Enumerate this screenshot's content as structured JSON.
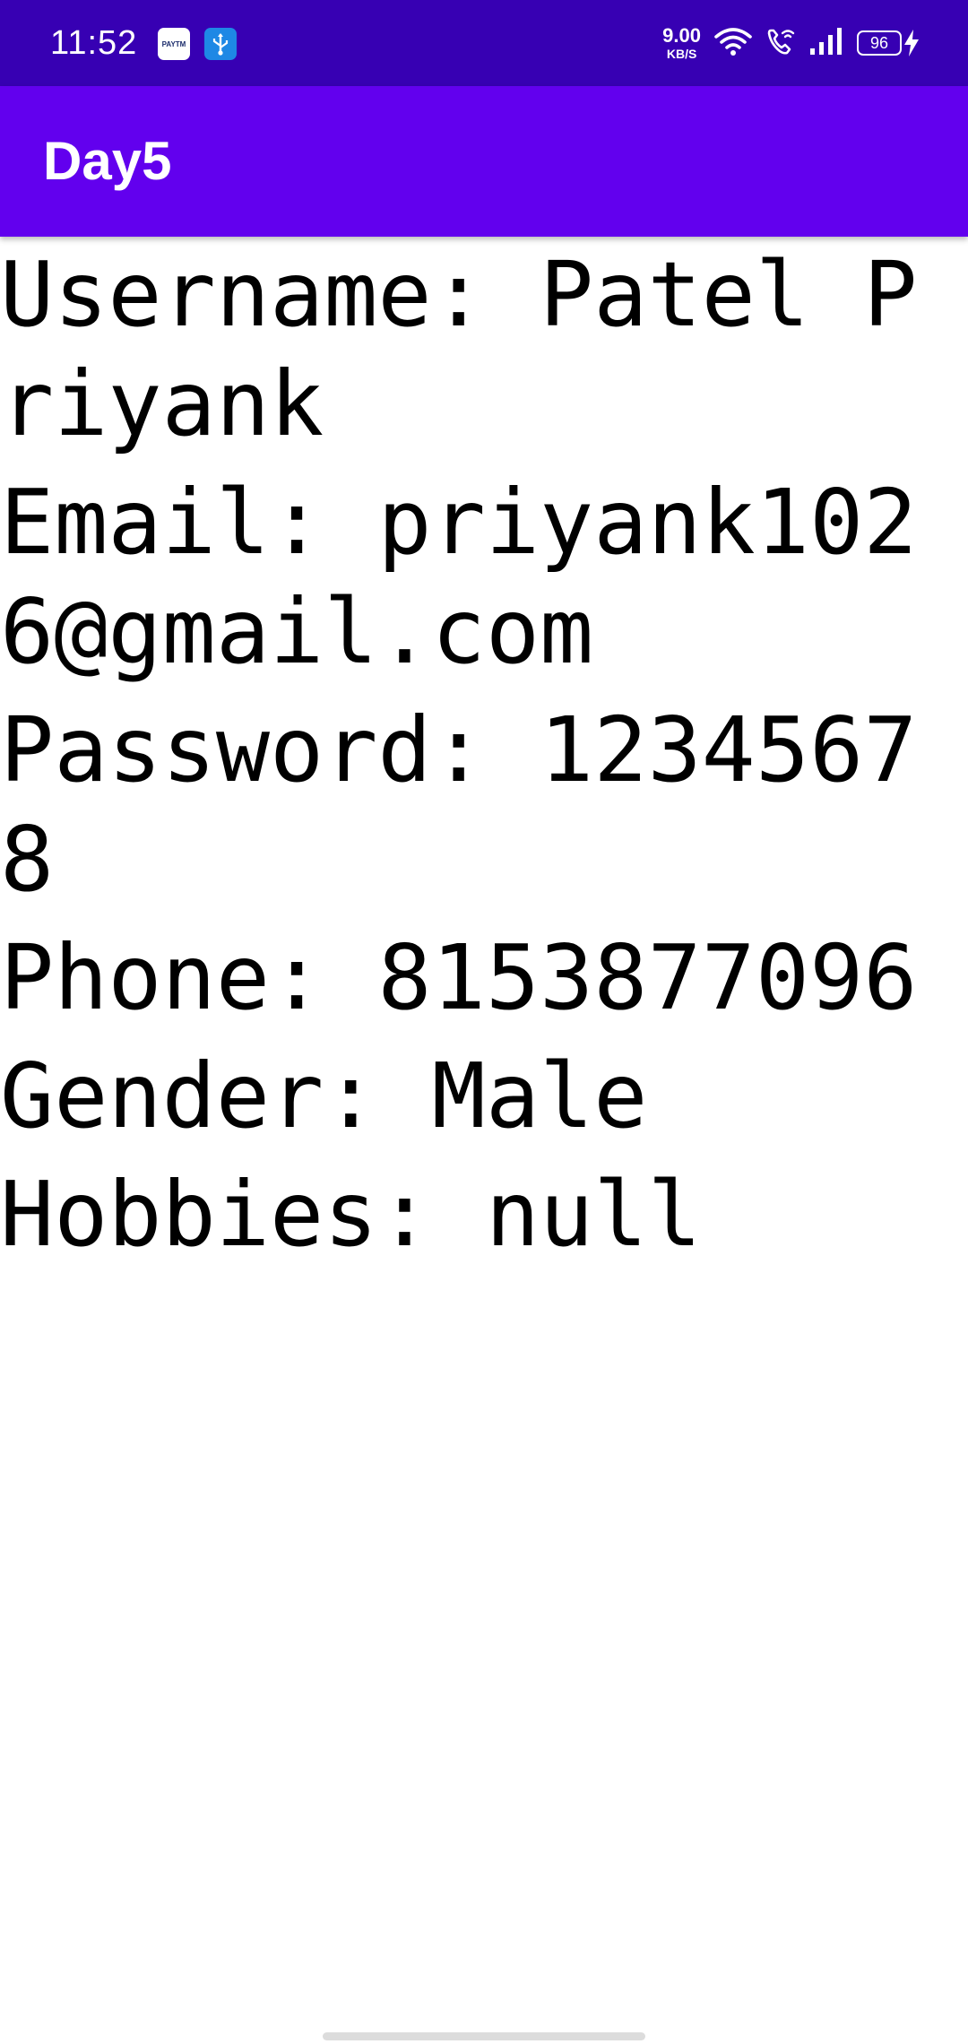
{
  "status_bar": {
    "time": "11:52",
    "notification_icons": [
      "paytm-icon",
      "usb-icon"
    ],
    "paytm_label": "PAYTM",
    "net_speed_value": "9.00",
    "net_speed_unit": "KB/S",
    "battery_level": "96",
    "background_color": "#3700B3"
  },
  "app_bar": {
    "title": "Day5",
    "background_color": "#6200EE"
  },
  "details": [
    "Username: Patel Priyank",
    "Email: priyank1026@gmail.com",
    "Password: 12345678",
    "Phone: 8153877096",
    "Gender: Male",
    "Hobbies: null"
  ]
}
